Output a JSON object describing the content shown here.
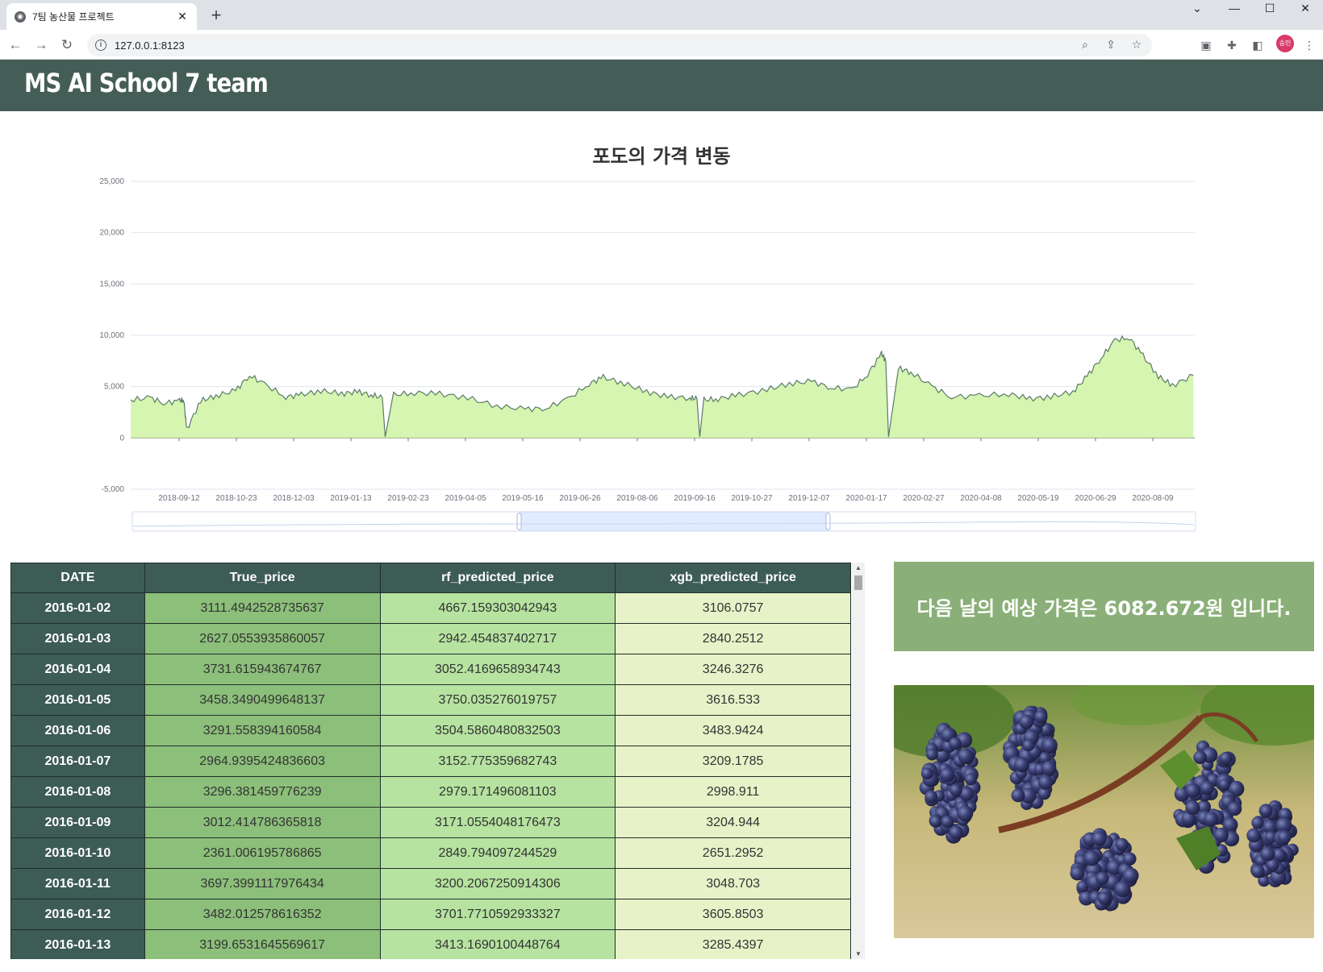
{
  "browser": {
    "tab_title": "7팀 농산물 프로젝트",
    "url": "127.0.0.1:8123",
    "profile_initials": "승민"
  },
  "header": {
    "title": "MS AI School 7 team"
  },
  "chart_data": {
    "type": "area",
    "title": "포도의 가격 변동",
    "xlabel": "",
    "ylabel": "",
    "ylim": [
      -5000,
      25000
    ],
    "yticks": [
      -5000,
      0,
      5000,
      10000,
      15000,
      20000,
      25000
    ],
    "ytick_labels": [
      "-5,000",
      "0",
      "5,000",
      "10,000",
      "15,000",
      "20,000",
      "25,000"
    ],
    "xtick_labels": [
      "2018-09-12",
      "2018-10-23",
      "2018-12-03",
      "2019-01-13",
      "2019-02-23",
      "2019-04-05",
      "2019-05-16",
      "2019-06-26",
      "2019-08-06",
      "2019-09-16",
      "2019-10-27",
      "2019-12-07",
      "2020-01-17",
      "2020-02-27",
      "2020-04-08",
      "2020-05-19",
      "2020-06-29",
      "2020-08-09"
    ],
    "x": [
      "2018-08-01",
      "2018-08-15",
      "2018-08-25",
      "2018-09-05",
      "2018-09-08",
      "2018-09-10",
      "2018-09-20",
      "2018-10-01",
      "2018-10-15",
      "2018-10-25",
      "2018-11-05",
      "2018-11-20",
      "2018-12-01",
      "2018-12-15",
      "2018-12-30",
      "2019-01-10",
      "2019-01-20",
      "2019-01-28",
      "2019-01-30",
      "2019-02-05",
      "2019-02-20",
      "2019-03-10",
      "2019-03-30",
      "2019-04-20",
      "2019-05-10",
      "2019-05-25",
      "2019-06-10",
      "2019-06-25",
      "2019-07-05",
      "2019-07-20",
      "2019-08-05",
      "2019-08-20",
      "2019-09-05",
      "2019-09-10",
      "2019-09-12",
      "2019-09-15",
      "2019-09-25",
      "2019-10-10",
      "2019-10-30",
      "2019-11-15",
      "2019-12-01",
      "2019-12-15",
      "2019-12-30",
      "2020-01-10",
      "2020-01-20",
      "2020-01-23",
      "2020-01-25",
      "2020-02-01",
      "2020-02-10",
      "2020-02-25",
      "2020-03-10",
      "2020-03-30",
      "2020-04-20",
      "2020-05-05",
      "2020-05-20",
      "2020-06-05",
      "2020-06-15",
      "2020-06-25",
      "2020-07-05",
      "2020-07-15",
      "2020-07-25",
      "2020-08-05",
      "2020-08-15",
      "2020-08-30"
    ],
    "series": [
      {
        "values": [
          3700,
          3900,
          3400,
          3600,
          3700,
          800,
          3600,
          4100,
          4600,
          6100,
          5200,
          4000,
          4200,
          4600,
          4300,
          4500,
          4200,
          3900,
          100,
          4200,
          4400,
          4300,
          3900,
          3100,
          2800,
          2900,
          3800,
          5300,
          5900,
          5300,
          4500,
          4000,
          3900,
          3800,
          100,
          3700,
          3800,
          4200,
          4700,
          5300,
          5500,
          4900,
          4700,
          6200,
          8200,
          7500,
          100,
          6800,
          6400,
          5000,
          4000,
          4100,
          4300,
          3800,
          4000,
          4500,
          6000,
          7800,
          9500,
          9800,
          8000,
          6000,
          5100,
          6100
        ]
      }
    ],
    "grid": true,
    "zoom_slider": true
  },
  "table": {
    "columns": [
      "DATE",
      "True_price",
      "rf_predicted_price",
      "xgb_predicted_price"
    ],
    "rows": [
      [
        "2016-01-02",
        "3111.4942528735637",
        "4667.159303042943",
        "3106.0757"
      ],
      [
        "2016-01-03",
        "2627.0553935860057",
        "2942.454837402717",
        "2840.2512"
      ],
      [
        "2016-01-04",
        "3731.615943674767",
        "3052.4169658934743",
        "3246.3276"
      ],
      [
        "2016-01-05",
        "3458.3490499648137",
        "3750.035276019757",
        "3616.533"
      ],
      [
        "2016-01-06",
        "3291.558394160584",
        "3504.5860480832503",
        "3483.9424"
      ],
      [
        "2016-01-07",
        "2964.9395424836603",
        "3152.775359682743",
        "3209.1785"
      ],
      [
        "2016-01-08",
        "3296.381459776239",
        "2979.171496081103",
        "2998.911"
      ],
      [
        "2016-01-09",
        "3012.414786365818",
        "3171.0554048176473",
        "3204.944"
      ],
      [
        "2016-01-10",
        "2361.006195786865",
        "2849.794097244529",
        "2651.2952"
      ],
      [
        "2016-01-11",
        "3697.3991117976434",
        "3200.2067250914306",
        "3048.703"
      ],
      [
        "2016-01-12",
        "3482.012578616352",
        "3701.7710592933327",
        "3605.8503"
      ],
      [
        "2016-01-13",
        "3199.6531645569617",
        "3413.1690100448764",
        "3285.4397"
      ]
    ]
  },
  "prediction": {
    "text": "다음 날의 예상 가격은 6082.672원 입니다."
  },
  "colors": {
    "header_bg": "#445e57",
    "area_fill": "#d5f5b0",
    "line": "#5b7a68",
    "price_box": "#8aaf78"
  }
}
